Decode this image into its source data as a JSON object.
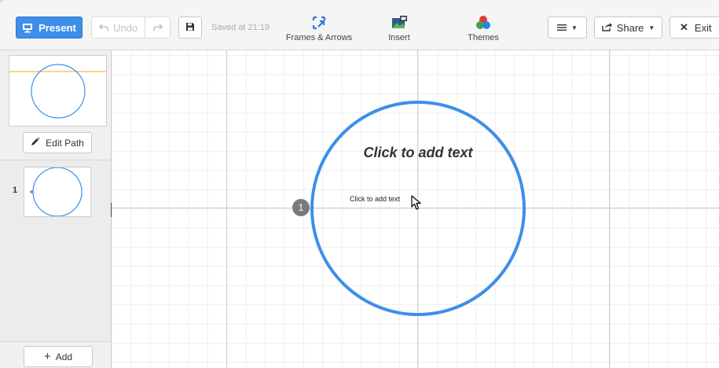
{
  "toolbar": {
    "present_label": "Present",
    "undo_label": "Undo",
    "saved_text": "Saved at 21:19",
    "tools": {
      "frames_label": "Frames & Arrows",
      "insert_label": "Insert",
      "themes_label": "Themes"
    },
    "share_label": "Share",
    "exit_label": "Exit"
  },
  "sidebar": {
    "edit_path_label": "Edit Path",
    "frames": [
      {
        "number": "1"
      }
    ],
    "add_label": "Add"
  },
  "canvas": {
    "title_placeholder": "Click to add text",
    "body_placeholder": "Click to add text",
    "frame_badge": "1"
  },
  "colors": {
    "accent": "#3d8fe8",
    "overview_line": "#f5a623"
  },
  "icons": {
    "present": "presentation-icon",
    "undo": "undo-icon",
    "redo": "redo-icon",
    "save": "save-icon",
    "frames": "frames-arrows-icon",
    "insert": "insert-image-icon",
    "themes": "themes-icon",
    "menu": "hamburger-menu-icon",
    "share": "share-icon",
    "exit": "close-icon",
    "edit_path": "pencil-icon",
    "add": "plus-icon"
  }
}
